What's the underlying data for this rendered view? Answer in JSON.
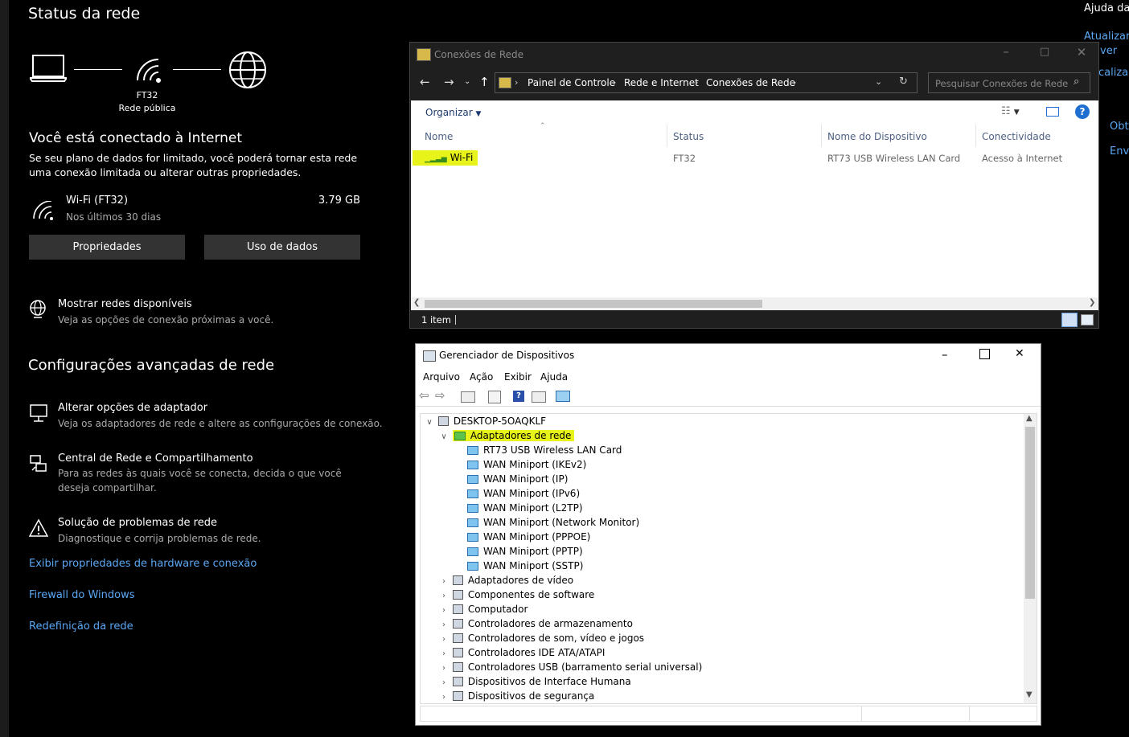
{
  "settings": {
    "title": "Status da rede",
    "network_name": "FT32",
    "network_type": "Rede pública",
    "connected_heading": "Você está conectado à Internet",
    "connected_desc": "Se seu plano de dados for limitado, você poderá tornar esta rede uma conexão limitada ou alterar outras propriedades.",
    "wifi_label": "Wi-Fi (FT32)",
    "wifi_period": "Nos últimos 30 dias",
    "wifi_usage": "3.79 GB",
    "btn_properties": "Propriedades",
    "btn_data_usage": "Uso de dados",
    "show_networks_title": "Mostrar redes disponíveis",
    "show_networks_desc": "Veja as opções de conexão próximas a você.",
    "advanced_heading": "Configurações avançadas de rede",
    "adapter_title": "Alterar opções de adaptador",
    "adapter_desc": "Veja os adaptadores de rede e altere as configurações de conexão.",
    "center_title": "Central de Rede e Compartilhamento",
    "center_desc": "Para as redes às quais você se conecta, decida o que você deseja compartilhar.",
    "troubleshoot_title": "Solução de problemas de rede",
    "troubleshoot_desc": "Diagnostique e corrija problemas de rede.",
    "link_hw": "Exibir propriedades de hardware e conexão",
    "link_firewall": "Firewall do Windows",
    "link_reset": "Redefinição da rede"
  },
  "right_edge": {
    "help": "Ajuda da",
    "l1": "Atualizar",
    "l2": "ver",
    "l3": "calizar",
    "l4": "Obt",
    "l5": "Envi"
  },
  "explorer": {
    "title": "Conexões de Rede",
    "breadcrumb": [
      "Painel de Controle",
      "Rede e Internet",
      "Conexões de Rede"
    ],
    "search_placeholder": "Pesquisar Conexões de Rede",
    "organize": "Organizar",
    "columns": [
      "Nome",
      "Status",
      "Nome do Dispositivo",
      "Conectividade"
    ],
    "row": {
      "name": "Wi-Fi",
      "status": "FT32",
      "device": "RT73 USB Wireless LAN Card",
      "connectivity": "Acesso à Internet"
    },
    "status_bar": "1 item",
    "help_glyph": "?"
  },
  "devmgr": {
    "title": "Gerenciador de Dispositivos",
    "menu": [
      "Arquivo",
      "Ação",
      "Exibir",
      "Ajuda"
    ],
    "root": "DESKTOP-5OAQKLF",
    "network_adapters": "Adaptadores de rede",
    "adapters": [
      "RT73 USB Wireless LAN Card",
      "WAN Miniport (IKEv2)",
      "WAN Miniport (IP)",
      "WAN Miniport (IPv6)",
      "WAN Miniport (L2TP)",
      "WAN Miniport (Network Monitor)",
      "WAN Miniport (PPPOE)",
      "WAN Miniport (PPTP)",
      "WAN Miniport (SSTP)"
    ],
    "categories": [
      "Adaptadores de vídeo",
      "Componentes de software",
      "Computador",
      "Controladores de armazenamento",
      "Controladores de som, vídeo e jogos",
      "Controladores IDE ATA/ATAPI",
      "Controladores USB (barramento serial universal)",
      "Dispositivos de Interface Humana",
      "Dispositivos de segurança"
    ]
  },
  "colors": {
    "highlight": "#e8f31a",
    "link_blue": "#5aa7f4",
    "dark_button": "#333333",
    "help_blue": "#1e6fd0"
  }
}
